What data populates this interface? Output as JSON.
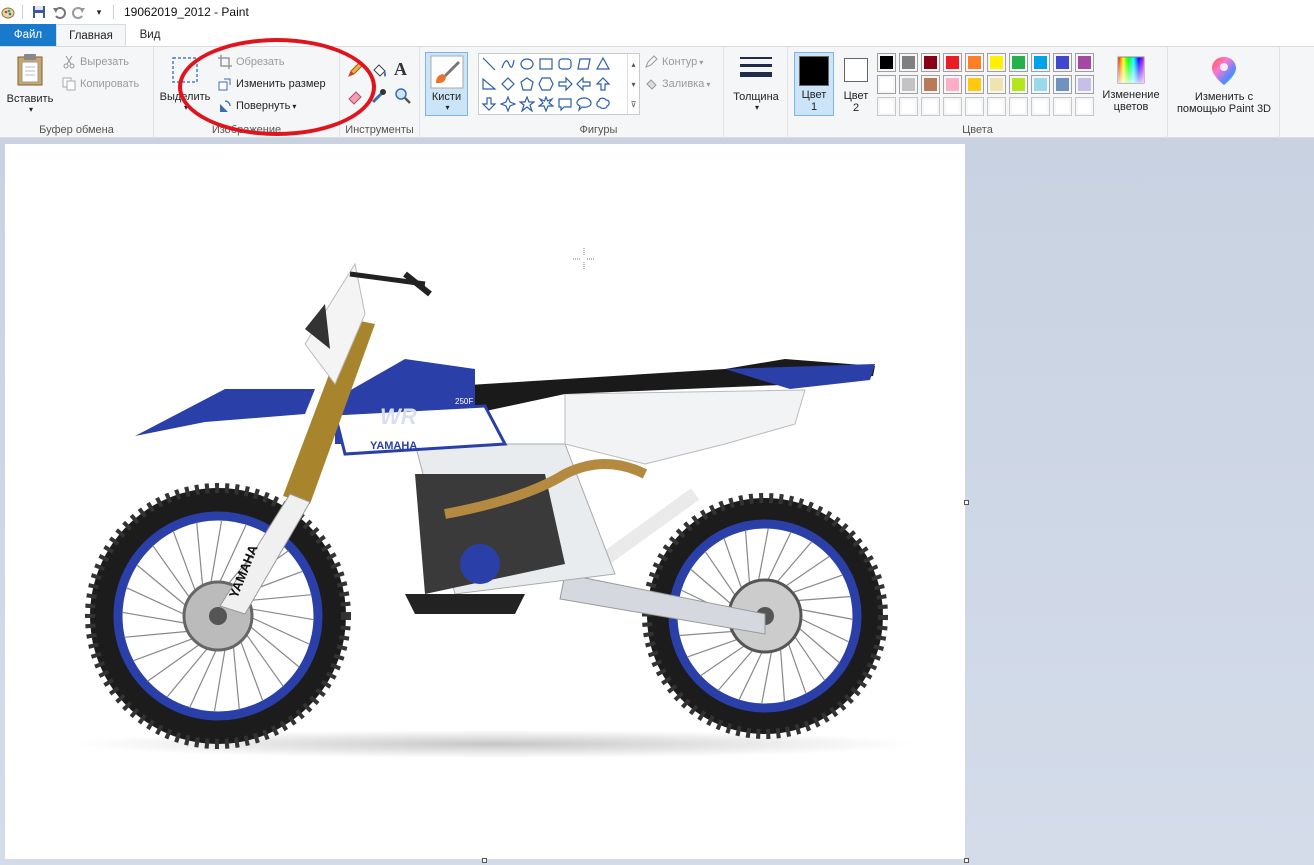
{
  "window": {
    "title": "19062019_2012 - Paint"
  },
  "tabs": {
    "file": "Файл",
    "home": "Главная",
    "view": "Вид"
  },
  "clipboard": {
    "paste": "Вставить",
    "cut": "Вырезать",
    "copy": "Копировать",
    "group": "Буфер обмена"
  },
  "image": {
    "select": "Выделить",
    "crop": "Обрезать",
    "resize": "Изменить размер",
    "rotate": "Повернуть",
    "group": "Изображение"
  },
  "tools": {
    "group": "Инструменты",
    "text_glyph": "A"
  },
  "brushes": {
    "label": "Кисти"
  },
  "shapes": {
    "outline": "Контур",
    "fill": "Заливка",
    "group": "Фигуры"
  },
  "size": {
    "label": "Толщина"
  },
  "colors": {
    "color1_line1": "Цвет",
    "color1_line2": "1",
    "color2_line1": "Цвет",
    "color2_line2": "2",
    "edit_line1": "Изменение",
    "edit_line2": "цветов",
    "group": "Цвета",
    "color1_value": "#000000",
    "color2_value": "#ffffff",
    "row1": [
      "#000000",
      "#7f7f7f",
      "#880015",
      "#ed1c24",
      "#ff7f27",
      "#fff200",
      "#22b14c",
      "#00a2e8",
      "#3f48cc",
      "#a349a4"
    ],
    "row2": [
      "#ffffff",
      "#c3c3c3",
      "#b97a57",
      "#ffaec9",
      "#ffc90e",
      "#efe4b0",
      "#b5e61d",
      "#99d9ea",
      "#7092be",
      "#c8bfe7"
    ],
    "row3": [
      "#ffffff",
      "#ffffff",
      "#ffffff",
      "#ffffff",
      "#ffffff",
      "#ffffff",
      "#ffffff",
      "#ffffff",
      "#ffffff",
      "#ffffff"
    ]
  },
  "paint3d": {
    "line1": "Изменить с",
    "line2": "помощью Paint 3D"
  },
  "canvas": {
    "fork_brand": "YAMAHA",
    "tank_brand": "YAMAHA",
    "model_badge": "WR",
    "model_code": "250F"
  }
}
